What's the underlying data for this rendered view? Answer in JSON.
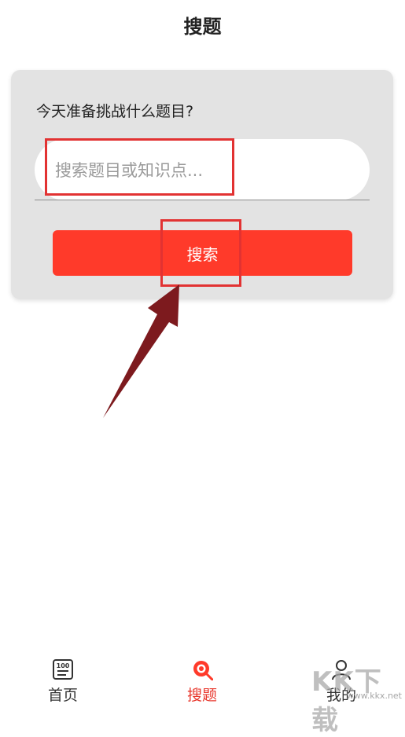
{
  "header": {
    "title": "搜题"
  },
  "search_card": {
    "prompt": "今天准备挑战什么题目?",
    "input": {
      "placeholder": "搜索题目或知识点...",
      "value": ""
    },
    "button_label": "搜索"
  },
  "tabbar": {
    "items": [
      {
        "label": "首页",
        "icon": "home-news-icon",
        "active": false
      },
      {
        "label": "搜题",
        "icon": "search-question-icon",
        "active": true
      },
      {
        "label": "我的",
        "icon": "user-icon",
        "active": false
      }
    ]
  },
  "watermark": {
    "text": "KK下载",
    "subtext": "www.kkx.net"
  },
  "colors": {
    "accent": "#ff3a2a",
    "highlight": "#e23232",
    "arrow": "#7d1a1e",
    "card_bg": "#e3e3e3"
  }
}
